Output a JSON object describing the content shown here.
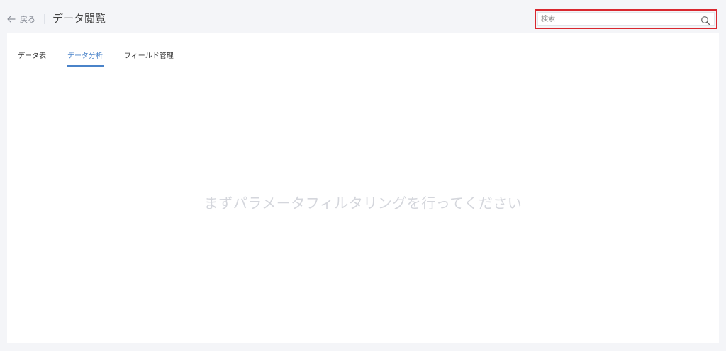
{
  "header": {
    "back_label": "戻る",
    "title": "データ閲覧"
  },
  "search": {
    "placeholder": "検索",
    "value": ""
  },
  "tabs": [
    {
      "label": "データ表",
      "active": false
    },
    {
      "label": "データ分析",
      "active": true
    },
    {
      "label": "フィールド管理",
      "active": false
    }
  ],
  "main": {
    "empty_message": "まずパラメータフィルタリングを行ってください"
  },
  "colors": {
    "accent": "#4a83c9",
    "highlight_border": "#d9272e",
    "background": "#f4f5f8",
    "empty_text": "#d4d6dc"
  },
  "icons": {
    "back": "arrow-left-icon",
    "search": "search-icon"
  }
}
